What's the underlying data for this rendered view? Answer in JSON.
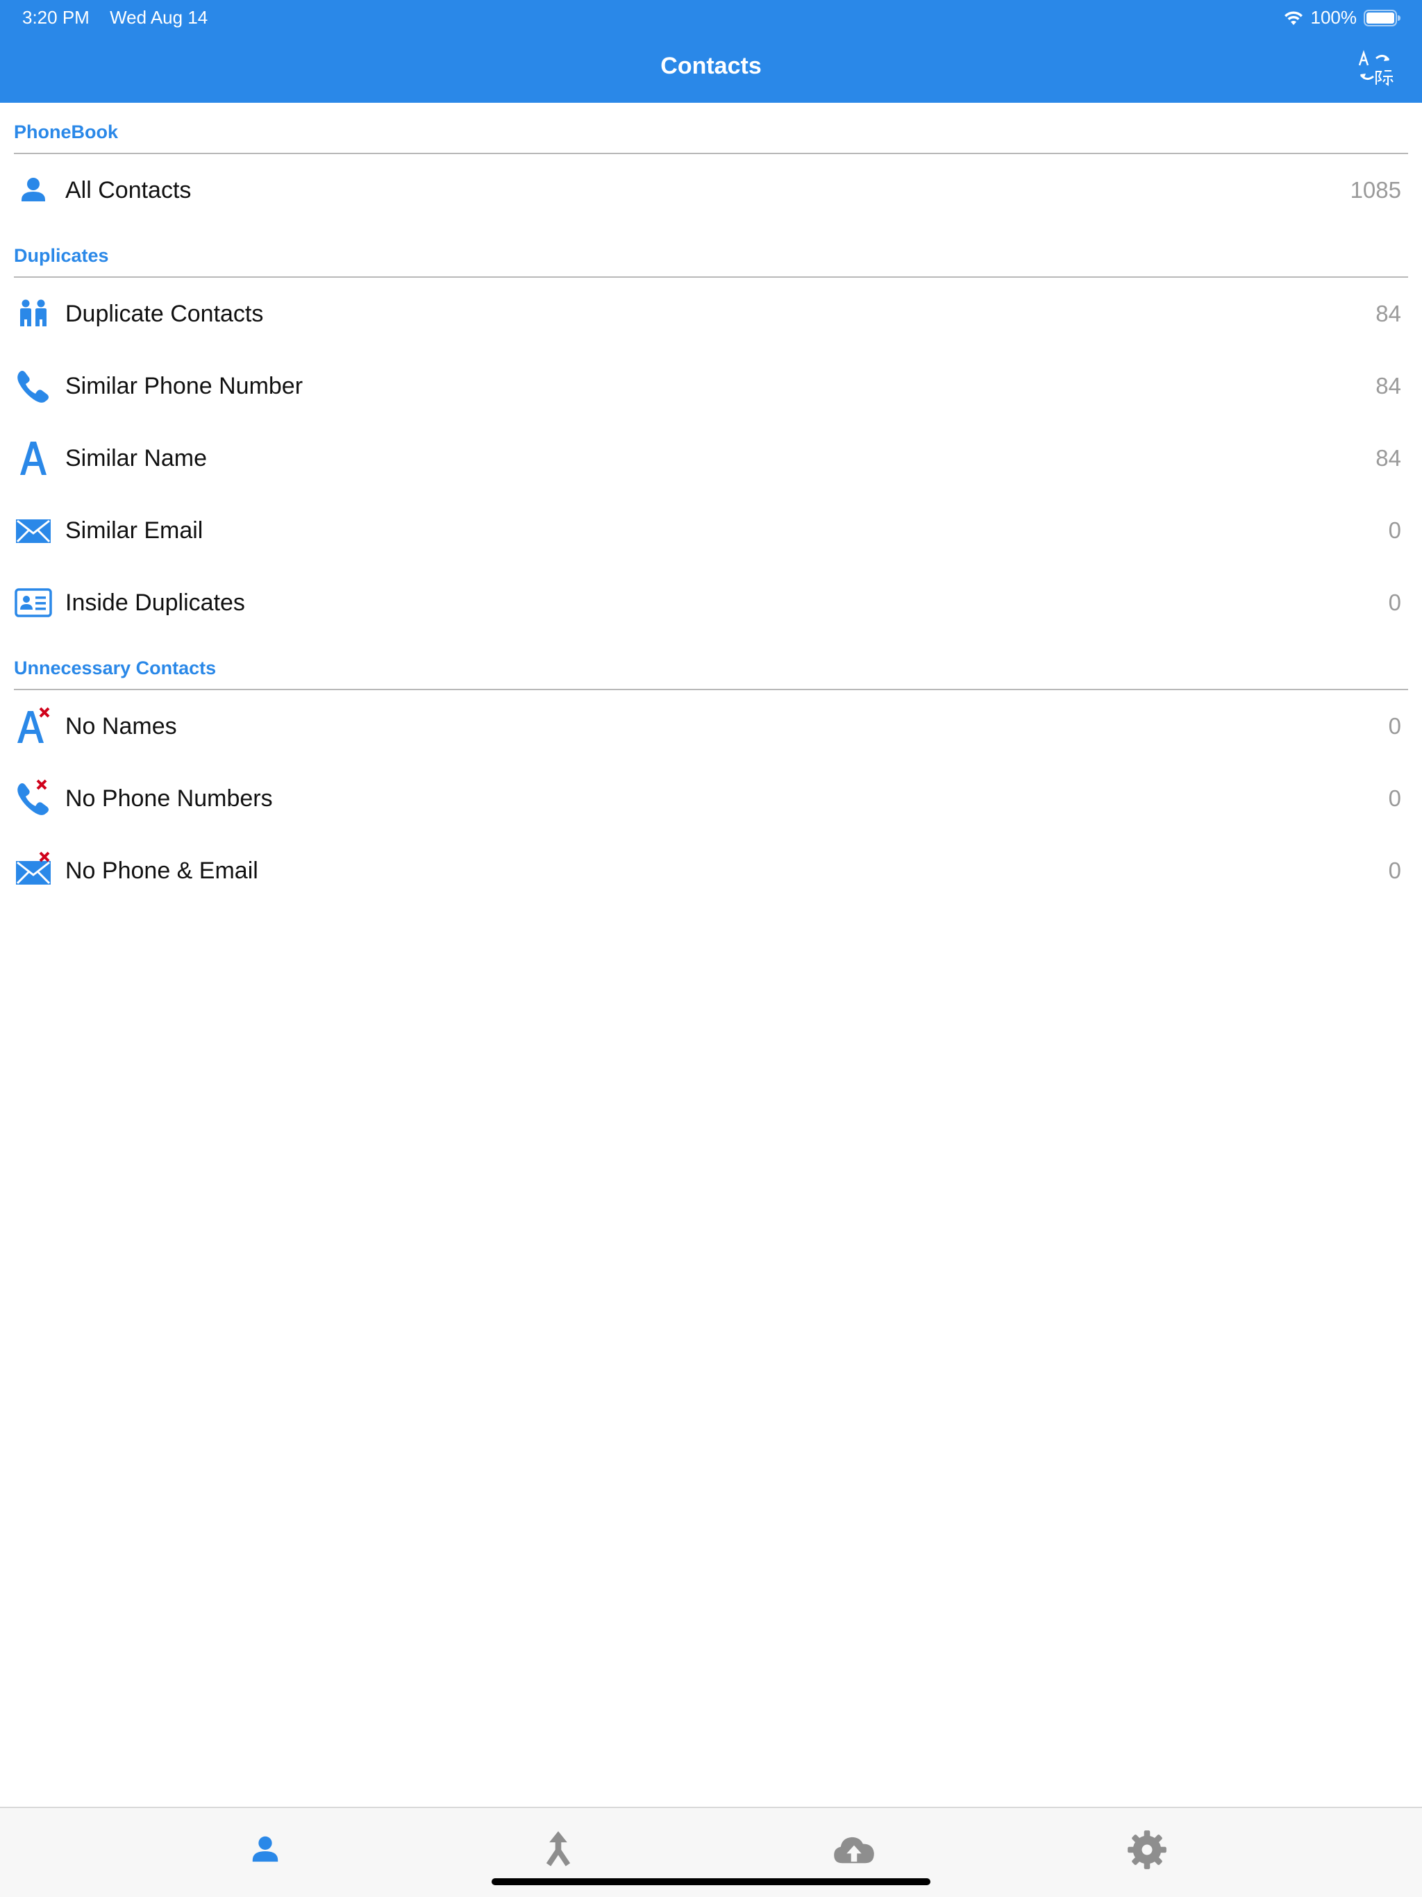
{
  "status_bar": {
    "time": "3:20 PM",
    "date": "Wed Aug 14",
    "battery": "100%",
    "icons": [
      "wifi-icon",
      "battery-icon"
    ]
  },
  "nav": {
    "title": "Contacts",
    "right_icon": "translate-icon"
  },
  "colors": {
    "accent": "#2a88e8",
    "count": "#9a9a9a",
    "delete_mark": "#d0021b",
    "tab_inactive": "#8e8e8e"
  },
  "sections": {
    "phonebook": {
      "title": "PhoneBook",
      "items": [
        {
          "label": "All Contacts",
          "count": "1085",
          "icon": "person-icon"
        }
      ]
    },
    "duplicates": {
      "title": "Duplicates",
      "items": [
        {
          "label": "Duplicate Contacts",
          "count": "84",
          "icon": "two-people-icon"
        },
        {
          "label": "Similar Phone Number",
          "count": "84",
          "icon": "phone-icon"
        },
        {
          "label": "Similar Name",
          "count": "84",
          "icon": "letter-a-icon"
        },
        {
          "label": "Similar Email",
          "count": "0",
          "icon": "envelope-icon"
        },
        {
          "label": "Inside Duplicates",
          "count": "0",
          "icon": "contact-card-icon"
        }
      ]
    },
    "unnecessary": {
      "title": "Unnecessary Contacts",
      "items": [
        {
          "label": "No Names",
          "count": "0",
          "icon": "letter-a-x-icon"
        },
        {
          "label": "No Phone Numbers",
          "count": "0",
          "icon": "phone-x-icon"
        },
        {
          "label": "No Phone & Email",
          "count": "0",
          "icon": "envelope-x-icon"
        }
      ]
    }
  },
  "tab_bar": {
    "selected": "contacts",
    "tabs": [
      {
        "id": "contacts",
        "icon": "person-icon"
      },
      {
        "id": "merge",
        "icon": "merge-arrow-icon"
      },
      {
        "id": "backup",
        "icon": "cloud-upload-icon"
      },
      {
        "id": "settings",
        "icon": "gear-icon"
      }
    ]
  }
}
